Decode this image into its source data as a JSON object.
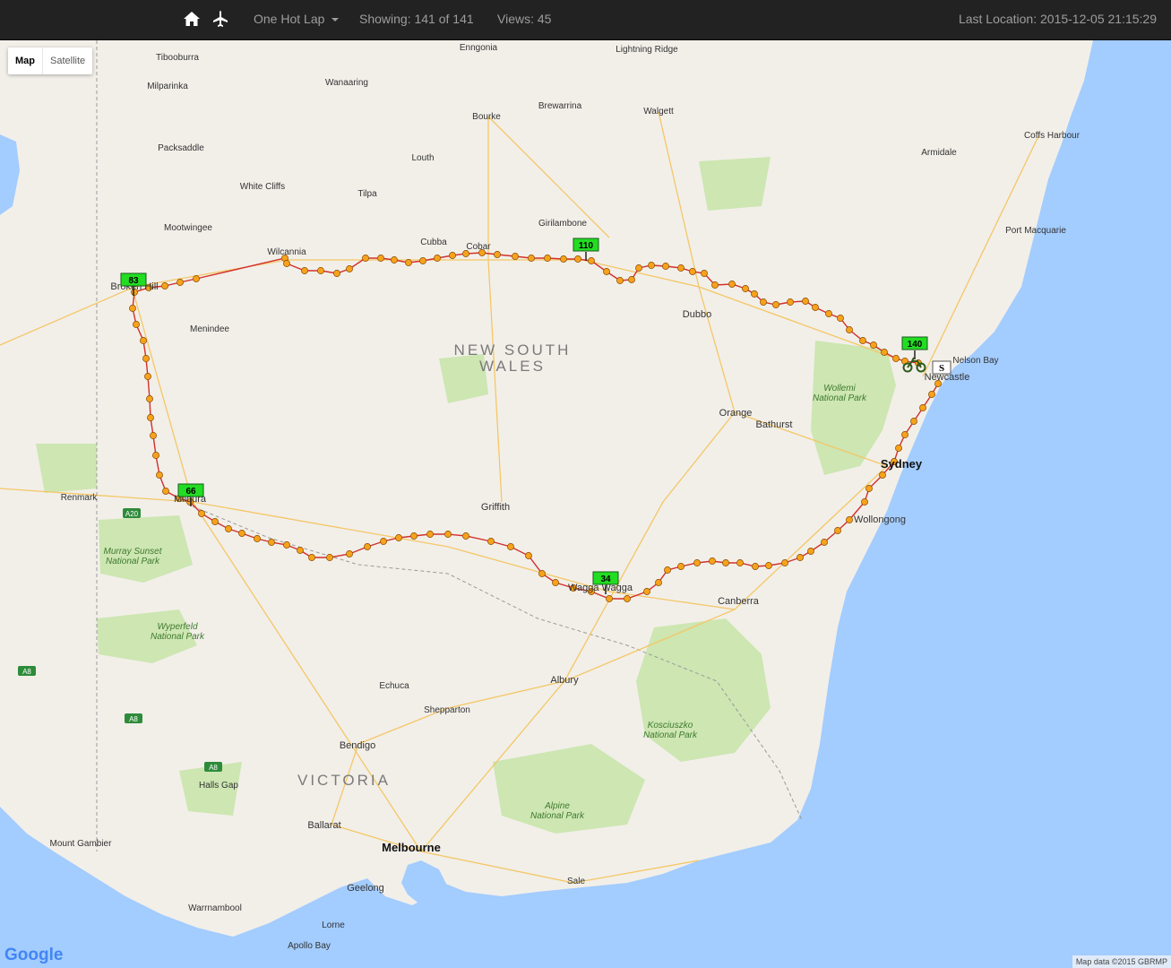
{
  "navbar": {
    "trip_menu_label": "One Hot Lap",
    "showing": "Showing: 141 of 141",
    "views": "Views: 45",
    "last_location": "Last Location: 2015-12-05 21:15:29"
  },
  "map_controls": {
    "map_type_buttons": [
      "Map",
      "Satellite"
    ],
    "active": "Map"
  },
  "region_labels": [
    "NEW SOUTH",
    "WALES",
    "VICTORIA"
  ],
  "place_labels": {
    "towns": [
      "Tibooburra",
      "Milparinka",
      "Packsaddle",
      "White Cliffs",
      "Mootwingee",
      "Wilcannia",
      "Broken Hill",
      "Menindee",
      "Wanaaring",
      "Enngonia",
      "Bourke",
      "Brewarrina",
      "Walgett",
      "Lightning Ridge",
      "Louth",
      "Tilpa",
      "Cobar",
      "Cubba",
      "Girilambone",
      "Dubbo",
      "Orange",
      "Bathurst",
      "Sydney",
      "Wollongong",
      "Newcastle",
      "Nelson Bay",
      "Port Macquarie",
      "Coffs Harbour",
      "Armidale",
      "Griffith",
      "Wagga Wagga",
      "Canberra",
      "Albury",
      "Shepparton",
      "Echuca",
      "Bendigo",
      "Ballarat",
      "Melbourne",
      "Geelong",
      "Warrnambool",
      "Lorne",
      "Apollo Bay",
      "Mount Gambier",
      "Halls Gap",
      "Mildura",
      "Renmark",
      "Sale"
    ],
    "parks": [
      "Wollemi National Park",
      "Murray Sunset National Park",
      "Wyperfeld National Park",
      "Kosciuszko National Park",
      "Alpine National Park"
    ],
    "roads": [
      "A20",
      "A8"
    ]
  },
  "markers": [
    "83",
    "110",
    "140",
    "66",
    "34",
    "S"
  ],
  "footer": {
    "logo": "Google",
    "attribution": "Map data ©2015 GBRMP"
  },
  "colors": {
    "navbar_bg": "#222222",
    "land": "#f2efe9",
    "water": "#a3ccff",
    "park": "#cde6b2",
    "route": "#d2302c",
    "route_dot": "#f7a21c",
    "marker": "#22dd22"
  }
}
